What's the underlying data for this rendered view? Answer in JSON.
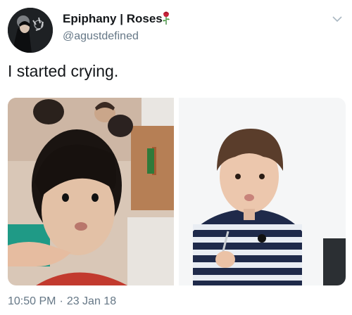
{
  "author": {
    "display_name": "Epiphany | Roses",
    "handle": "@agustdefined",
    "avatar_icon": "avatar-photo",
    "name_emoji": "rose-icon"
  },
  "tweet": {
    "text": "I started crying.",
    "time": "10:50 PM",
    "separator": "·",
    "date": "23 Jan 18"
  },
  "media": [
    {
      "description_icon": "photo"
    },
    {
      "description_icon": "photo"
    }
  ],
  "colors": {
    "text": "#14171a",
    "secondary": "#657786",
    "background": "#ffffff"
  }
}
